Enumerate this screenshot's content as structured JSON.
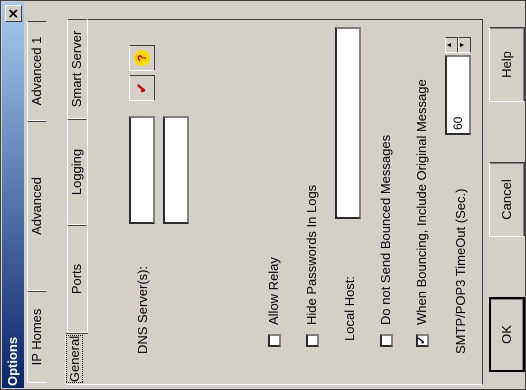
{
  "window": {
    "title": "Options",
    "close_glyph": "✕"
  },
  "tabs": {
    "row_back": [
      "IP Homes",
      "Advanced",
      "Advanced 1"
    ],
    "row_front": [
      "General",
      "Ports",
      "Logging",
      "Smart Server"
    ]
  },
  "general": {
    "dns_label": "DNS Server(s):",
    "allow_relay": "Allow Relay",
    "hide_passwords": "Hide Passwords In Logs",
    "local_host_label": "Local Host:",
    "no_bounce": "Do not Send Bounced Messages",
    "bounce_include": "When Bouncing, Include Original Message",
    "timeout_label": "SMTP/POP3 TimeOut (Sec.)",
    "timeout_value": "60",
    "allow_relay_checked": false,
    "hide_passwords_checked": false,
    "no_bounce_checked": false,
    "bounce_include_checked": true,
    "check_glyph": "✓"
  },
  "icons": {
    "validate": "check-icon",
    "help": "question-icon"
  },
  "buttons": {
    "ok": "OK",
    "cancel": "Cancel",
    "help": "Help"
  },
  "colors": {
    "titlebar_start": "#0a246a",
    "titlebar_end": "#a6caf0",
    "face": "#d4d0c8",
    "check_red": "#cc0000"
  }
}
